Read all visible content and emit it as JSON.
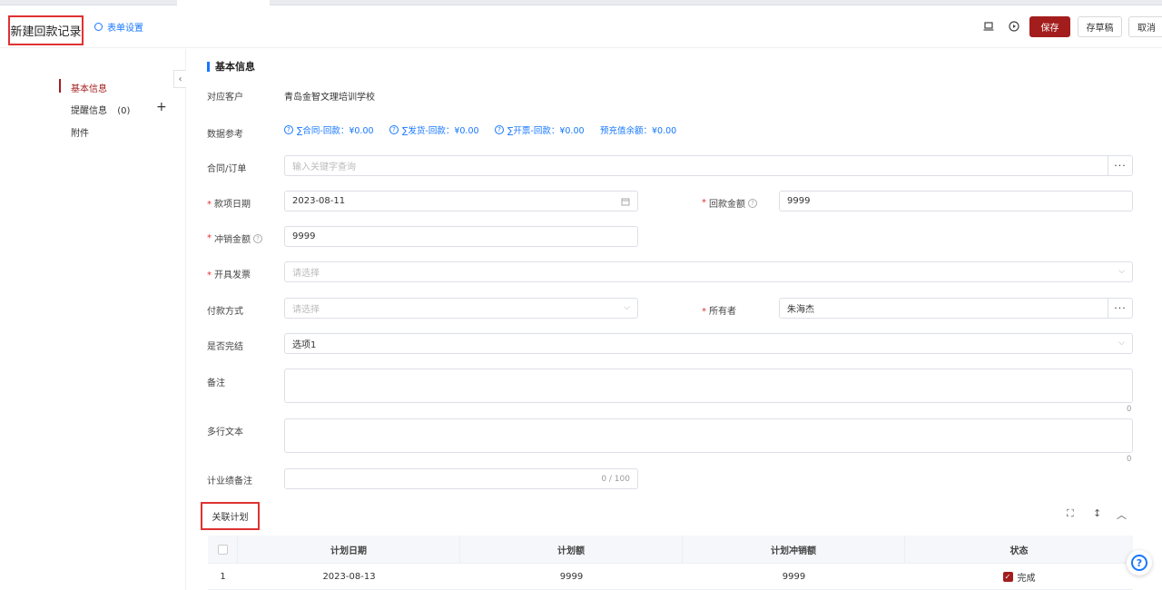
{
  "header": {
    "title": "新建回款记录",
    "form_settings": "表单设置",
    "save": "保存",
    "draft": "存草稿",
    "cancel": "取消"
  },
  "sidebar": {
    "items": [
      {
        "label": "基本信息"
      },
      {
        "label": "提醒信息",
        "count": "(0)"
      },
      {
        "label": "附件"
      }
    ]
  },
  "section": {
    "title": "基本信息"
  },
  "form": {
    "customer": {
      "label": "对应客户",
      "value": "青岛金智文理培训学校"
    },
    "data_ref": {
      "label": "数据参考",
      "items": [
        "∑合同-回款：¥0.00",
        "∑发货-回款：¥0.00",
        "∑开票-回款：¥0.00",
        "预充值余额：¥0.00"
      ]
    },
    "contract": {
      "label": "合同/订单",
      "placeholder": "输入关键字查询"
    },
    "date": {
      "label": "款项日期",
      "value": "2023-08-11"
    },
    "amount": {
      "label": "回款金额",
      "value": "9999"
    },
    "offset": {
      "label": "冲销金额",
      "value": "9999"
    },
    "invoice": {
      "label": "开具发票",
      "placeholder": "请选择"
    },
    "payment": {
      "label": "付款方式",
      "placeholder": "请选择"
    },
    "owner": {
      "label": "所有者",
      "value": "朱海杰"
    },
    "finished": {
      "label": "是否完结",
      "value": "选项1"
    },
    "remark": {
      "label": "备注",
      "count": "0"
    },
    "multiline": {
      "label": "多行文本",
      "count": "0"
    },
    "perf_remark": {
      "label": "计业绩备注",
      "count": "0 / 100"
    }
  },
  "related": {
    "title": "关联计划",
    "columns": [
      "计划日期",
      "计划额",
      "计划冲销额",
      "状态"
    ],
    "rows": [
      {
        "index": "1",
        "date": "2023-08-13",
        "amount": "9999",
        "offset": "9999",
        "status": "完成"
      }
    ]
  }
}
